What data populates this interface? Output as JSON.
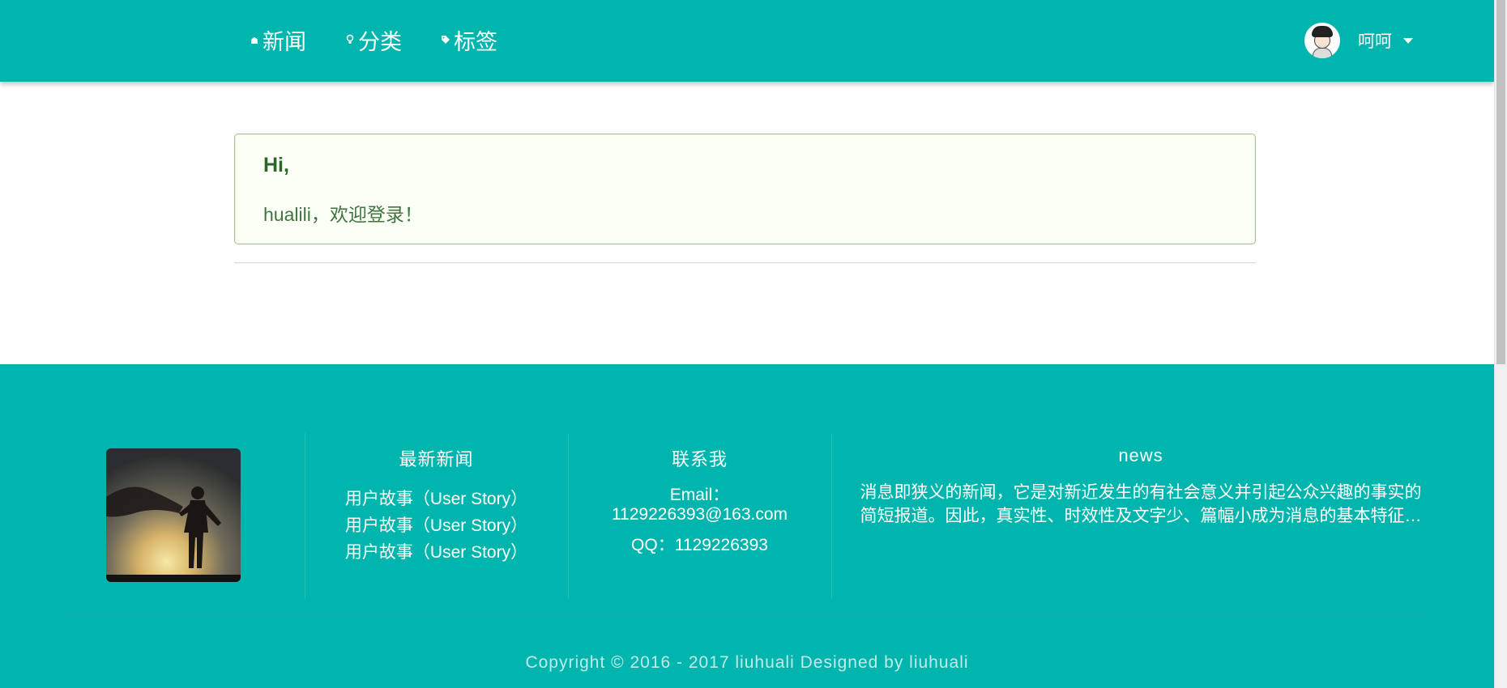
{
  "nav": {
    "items": [
      {
        "label": "新闻",
        "icon": "home-icon"
      },
      {
        "label": "分类",
        "icon": "lightbulb-icon"
      },
      {
        "label": "标签",
        "icon": "tag-icon"
      }
    ]
  },
  "user": {
    "name": "呵呵"
  },
  "message": {
    "header": "Hi,",
    "text": "hualili，欢迎登录！"
  },
  "footer": {
    "latest_news": {
      "title": "最新新闻",
      "items": [
        "用户故事（User Story）",
        "用户故事（User Story）",
        "用户故事（User Story）"
      ]
    },
    "contact": {
      "title": "联系我",
      "email_label": "Email：",
      "email": "1129226393@163.com",
      "qq": "QQ：1129226393"
    },
    "news": {
      "title": "news",
      "text": "消息即狭义的新闻，它是对新近发生的有社会意义并引起公众兴趣的事实的简短报道。因此，真实性、时效性及文字少、篇幅小成为消息的基本特征…"
    },
    "copyright": "Copyright © 2016 - 2017 liuhuali Designed by liuhuali"
  },
  "colors": {
    "primary": "#00b5ad",
    "success_bg": "#fcfff5",
    "success_border": "#a3c293",
    "success_text": "#2c662d"
  }
}
